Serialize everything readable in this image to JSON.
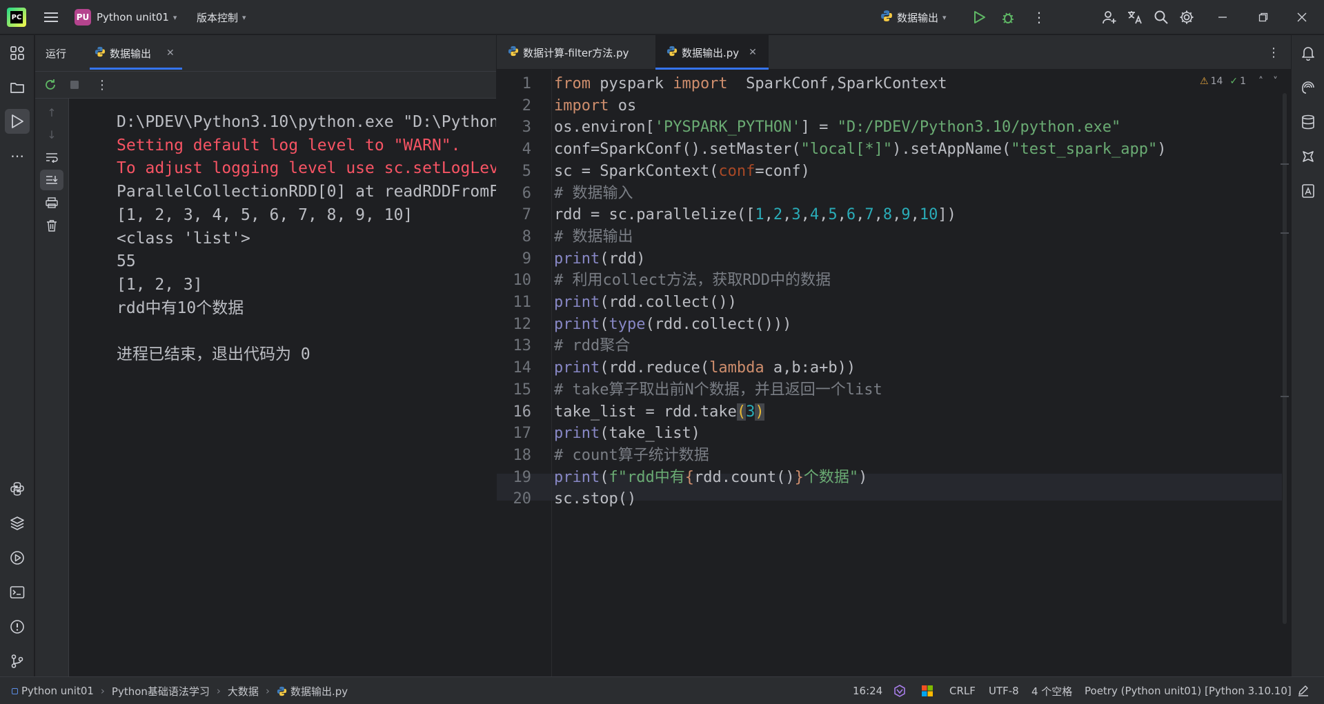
{
  "titlebar": {
    "project_badge": "PU",
    "project_name": "Python unit01",
    "vcs_label": "版本控制",
    "run_config": "数据输出"
  },
  "run_panel": {
    "title": "运行",
    "tab_label": "数据输出",
    "console_lines": [
      {
        "text": "D:\\PDEV\\Python3.10\\python.exe \"D:\\Python",
        "type": "normal"
      },
      {
        "text": "Setting default log level to \"WARN\".",
        "type": "err"
      },
      {
        "text": "To adjust logging level use sc.setLogLev",
        "type": "err"
      },
      {
        "text": "ParallelCollectionRDD[0] at readRDDFromF",
        "type": "normal"
      },
      {
        "text": "[1, 2, 3, 4, 5, 6, 7, 8, 9, 10]",
        "type": "normal"
      },
      {
        "text": "<class 'list'>",
        "type": "normal"
      },
      {
        "text": "55",
        "type": "normal"
      },
      {
        "text": "[1, 2, 3]",
        "type": "normal"
      },
      {
        "text": "rdd中有10个数据",
        "type": "normal"
      },
      {
        "text": "",
        "type": "normal"
      },
      {
        "text": "进程已结束，退出代码为 0",
        "type": "normal"
      }
    ]
  },
  "editor": {
    "tabs": [
      {
        "label": "数据计算-filter方法.py",
        "active": false
      },
      {
        "label": "数据输出.py",
        "active": true
      }
    ],
    "warnings": "14",
    "weak_warnings": "1",
    "current_line": 16,
    "line_numbers": [
      "1",
      "2",
      "3",
      "4",
      "5",
      "6",
      "7",
      "8",
      "9",
      "10",
      "11",
      "12",
      "13",
      "14",
      "15",
      "16",
      "17",
      "18",
      "19",
      "20"
    ],
    "code": [
      [
        {
          "t": "from",
          "c": "kw"
        },
        {
          "t": " pyspark ",
          "c": ""
        },
        {
          "t": "import",
          "c": "kw"
        },
        {
          "t": "  SparkConf,SparkContext",
          "c": ""
        }
      ],
      [
        {
          "t": "import",
          "c": "kw"
        },
        {
          "t": " os",
          "c": ""
        }
      ],
      [
        {
          "t": "os.environ[",
          "c": ""
        },
        {
          "t": "'PYSPARK_PYTHON'",
          "c": "str"
        },
        {
          "t": "] = ",
          "c": ""
        },
        {
          "t": "\"D:/PDEV/Python3.10/python.exe\"",
          "c": "str"
        }
      ],
      [
        {
          "t": "conf=SparkConf().setMaster(",
          "c": ""
        },
        {
          "t": "\"local[*]\"",
          "c": "str"
        },
        {
          "t": ").setAppName(",
          "c": ""
        },
        {
          "t": "\"test_spark_app\"",
          "c": "str"
        },
        {
          "t": ")",
          "c": ""
        }
      ],
      [
        {
          "t": "sc = SparkContext(",
          "c": ""
        },
        {
          "t": "conf",
          "c": "prm"
        },
        {
          "t": "=conf)",
          "c": ""
        }
      ],
      [
        {
          "t": "# 数据输入",
          "c": "cmt"
        }
      ],
      [
        {
          "t": "rdd = sc.parallelize([",
          "c": ""
        },
        {
          "t": "1",
          "c": "num"
        },
        {
          "t": ",",
          "c": ""
        },
        {
          "t": "2",
          "c": "num"
        },
        {
          "t": ",",
          "c": ""
        },
        {
          "t": "3",
          "c": "num"
        },
        {
          "t": ",",
          "c": ""
        },
        {
          "t": "4",
          "c": "num"
        },
        {
          "t": ",",
          "c": ""
        },
        {
          "t": "5",
          "c": "num"
        },
        {
          "t": ",",
          "c": ""
        },
        {
          "t": "6",
          "c": "num"
        },
        {
          "t": ",",
          "c": ""
        },
        {
          "t": "7",
          "c": "num"
        },
        {
          "t": ",",
          "c": ""
        },
        {
          "t": "8",
          "c": "num"
        },
        {
          "t": ",",
          "c": ""
        },
        {
          "t": "9",
          "c": "num"
        },
        {
          "t": ",",
          "c": ""
        },
        {
          "t": "10",
          "c": "num"
        },
        {
          "t": "])",
          "c": ""
        }
      ],
      [
        {
          "t": "# 数据输出",
          "c": "cmt"
        }
      ],
      [
        {
          "t": "print",
          "c": "fn"
        },
        {
          "t": "(rdd)",
          "c": ""
        }
      ],
      [
        {
          "t": "# 利用collect方法，获取RDD中的数据",
          "c": "cmt"
        }
      ],
      [
        {
          "t": "print",
          "c": "fn"
        },
        {
          "t": "(rdd.collect())",
          "c": ""
        }
      ],
      [
        {
          "t": "print",
          "c": "fn"
        },
        {
          "t": "(",
          "c": ""
        },
        {
          "t": "type",
          "c": "fn"
        },
        {
          "t": "(rdd.collect()))",
          "c": ""
        }
      ],
      [
        {
          "t": "# rdd聚合",
          "c": "cmt"
        }
      ],
      [
        {
          "t": "print",
          "c": "fn"
        },
        {
          "t": "(rdd.reduce(",
          "c": ""
        },
        {
          "t": "lambda",
          "c": "kw"
        },
        {
          "t": " a,b:a+b))",
          "c": ""
        }
      ],
      [
        {
          "t": "# take算子取出前N个数据，并且返回一个list",
          "c": "cmt"
        }
      ],
      [
        {
          "t": "take_list = rdd.take",
          "c": ""
        },
        {
          "t": "(",
          "c": "bracket"
        },
        {
          "t": "3",
          "c": "num"
        },
        {
          "t": ")",
          "c": "bracket"
        }
      ],
      [
        {
          "t": "print",
          "c": "fn"
        },
        {
          "t": "(take_list)",
          "c": ""
        }
      ],
      [
        {
          "t": "# count算子统计数据",
          "c": "cmt"
        }
      ],
      [
        {
          "t": "print",
          "c": "fn"
        },
        {
          "t": "(",
          "c": ""
        },
        {
          "t": "f\"rdd中有",
          "c": "str"
        },
        {
          "t": "{",
          "c": "kw"
        },
        {
          "t": "rdd.count()",
          "c": ""
        },
        {
          "t": "}",
          "c": "kw"
        },
        {
          "t": "个数据\"",
          "c": "str"
        },
        {
          "t": ")",
          "c": ""
        }
      ],
      [
        {
          "t": "sc.stop()",
          "c": ""
        }
      ]
    ]
  },
  "statusbar": {
    "breadcrumb": [
      "Python unit01",
      "Python基础语法学习",
      "大数据",
      "数据输出.py"
    ],
    "position": "16:24",
    "line_sep": "CRLF",
    "encoding": "UTF-8",
    "indent": "4 个空格",
    "interpreter": "Poetry (Python unit01) [Python 3.10.10]"
  },
  "colors": {
    "accent": "#3574f0",
    "error_text": "#f75464",
    "keyword": "#cf8e6d",
    "string": "#6aab73",
    "number": "#2aacb8"
  }
}
